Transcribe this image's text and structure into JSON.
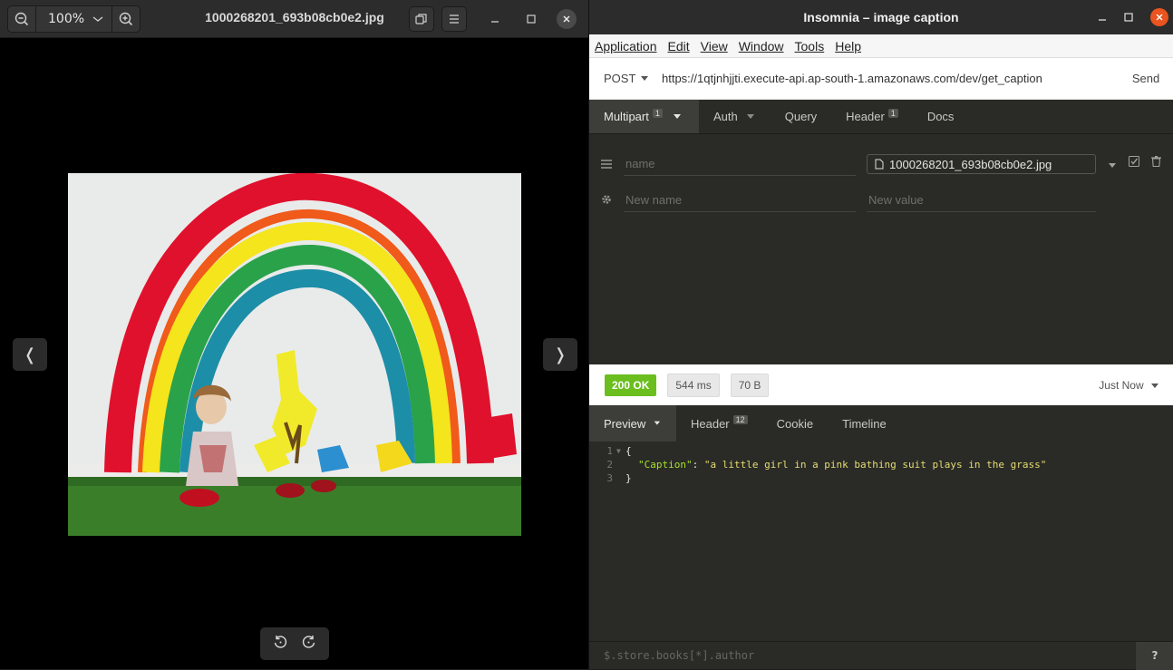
{
  "viewer": {
    "zoom_label": "100%",
    "filename": "1000268201_693b08cb0e2.jpg",
    "prev_glyph": "❬",
    "next_glyph": "❭",
    "icons": {
      "zoom_out": "zoom-out-icon",
      "zoom_in": "zoom-in-icon",
      "dropdown": "chevron-down-icon",
      "window_mode": "restore-icon",
      "menu": "hamburger-icon",
      "rotate_left": "rotate-left-icon",
      "rotate_right": "rotate-right-icon"
    }
  },
  "app": {
    "title": "Insomnia – image caption",
    "menu": [
      "Application",
      "Edit",
      "View",
      "Window",
      "Tools",
      "Help"
    ],
    "method": "POST",
    "url": "https://1qtjnhjjti.execute-api.ap-south-1.amazonaws.com/dev/get_caption",
    "send_label": "Send"
  },
  "request_tabs": [
    {
      "label": "Multipart",
      "badge": "1"
    },
    {
      "label": "Auth",
      "badge": ""
    },
    {
      "label": "Query",
      "badge": ""
    },
    {
      "label": "Header",
      "badge": "1"
    },
    {
      "label": "Docs",
      "badge": ""
    }
  ],
  "params": {
    "row1": {
      "name_placeholder": "name",
      "file": "1000268201_693b08cb0e2.jpg"
    },
    "row2": {
      "name_placeholder": "New name",
      "value_placeholder": "New value"
    }
  },
  "response": {
    "status": "200 OK",
    "time": "544 ms",
    "size": "70 B",
    "when": "Just Now",
    "tabs": [
      {
        "label": "Preview",
        "badge": ""
      },
      {
        "label": "Header",
        "badge": "12"
      },
      {
        "label": "Cookie",
        "badge": ""
      },
      {
        "label": "Timeline",
        "badge": ""
      }
    ],
    "lines": {
      "l1": {
        "num": "1",
        "text": "{"
      },
      "l2": {
        "num": "2",
        "key": "\"Caption\"",
        "sep": ": ",
        "value": "\"a little girl in a pink bathing suit plays in the grass\""
      },
      "l3": {
        "num": "3",
        "text": "}"
      }
    },
    "filter_placeholder": "$.store.books[*].author",
    "help_glyph": "?"
  },
  "colors": {
    "status_ok": "#6abe1e",
    "close_button": "#e95420",
    "json_key": "#a6e22e",
    "json_string": "#e6db74"
  }
}
